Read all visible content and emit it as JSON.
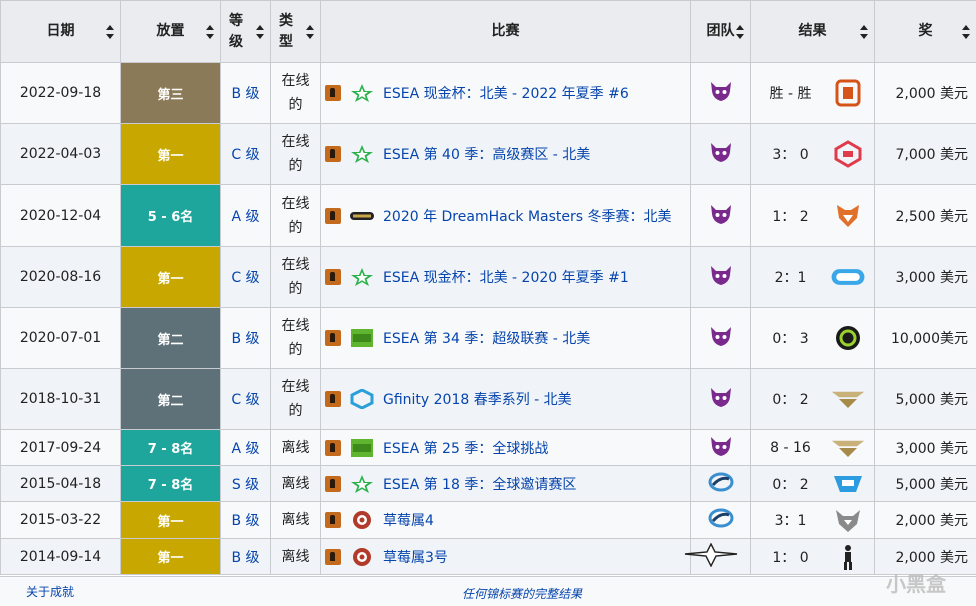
{
  "headers": {
    "date": "日期",
    "place": "放置",
    "tier": "等级",
    "type": "类型",
    "tournament": "比赛",
    "team": "团队",
    "result": "结果",
    "prize": "奖"
  },
  "rows": [
    {
      "date": "2022-09-18",
      "place": "第三",
      "tier": "B 级",
      "type": "在线的",
      "tournament": "ESEA 现金杯：北美 - 2022 年夏季 #6",
      "org": "star",
      "team": "demon",
      "score": "胜 - 胜",
      "opp": "dc",
      "prize": "2,000 美元",
      "placeColor": "#8b7a57"
    },
    {
      "date": "2022-04-03",
      "place": "第一",
      "tier": "C 级",
      "type": "在线的",
      "tournament": "ESEA 第 40 季：高级赛区 - 北美",
      "org": "star",
      "team": "demon",
      "score": "3： 0",
      "opp": "gc",
      "prize": "7,000 美元",
      "placeColor": "#c8a800"
    },
    {
      "date": "2020-12-04",
      "place": "5 - 6名",
      "tier": "A 级",
      "type": "在线的",
      "tournament": "2020 年 DreamHack Masters 冬季赛：北美",
      "org": "masters",
      "team": "demon",
      "score": "1： 2",
      "opp": "fox",
      "prize": "2,500 美元",
      "placeColor": "#1fa69c"
    },
    {
      "date": "2020-08-16",
      "place": "第一",
      "tier": "C 级",
      "type": "在线的",
      "tournament": "ESEA 现金杯：北美 - 2020 年夏季 #1",
      "org": "star",
      "team": "demon",
      "score": "2：1",
      "opp": "pd",
      "prize": "3,000 美元",
      "placeColor": "#c8a800"
    },
    {
      "date": "2020-07-01",
      "place": "第二",
      "tier": "B 级",
      "type": "在线的",
      "tournament": "ESEA 第 34 季：超级联赛 - 北美",
      "org": "mdl",
      "team": "demon",
      "score": "0： 3",
      "opp": "ring",
      "prize": "10,000美元",
      "placeColor": "#5e7178"
    },
    {
      "date": "2018-10-31",
      "place": "第二",
      "tier": "C 级",
      "type": "在线的",
      "tournament": "Gfinity 2018 春季系列 - 北美",
      "org": "gfinity",
      "team": "demon",
      "score": "0： 2",
      "opp": "wings",
      "prize": "5,000 美元",
      "placeColor": "#5e7178"
    },
    {
      "date": "2017-09-24",
      "place": "7 - 8名",
      "tier": "A 级",
      "type": "离线",
      "tournament": "ESEA 第 25 季：全球挑战",
      "org": "mdl",
      "team": "demon",
      "score": "8 - 16",
      "opp": "wings",
      "prize": "3,000 美元",
      "placeColor": "#1fa69c"
    },
    {
      "date": "2015-04-18",
      "place": "7 - 8名",
      "tier": "S 级",
      "type": "离线",
      "tournament": "ESEA 第 18 季：全球邀请赛区",
      "org": "star",
      "team": "swirl",
      "score": "0： 2",
      "opp": "clg",
      "prize": "5,000 美元",
      "placeColor": "#1fa69c"
    },
    {
      "date": "2015-03-22",
      "place": "第一",
      "tier": "B 级",
      "type": "离线",
      "tournament": "草莓属4",
      "org": "fragaria",
      "team": "swirl",
      "score": "3：1",
      "opp": "wolf",
      "prize": "2,000 美元",
      "placeColor": "#c8a800"
    },
    {
      "date": "2014-09-14",
      "place": "第一",
      "tier": "B 级",
      "type": "离线",
      "tournament": "草莓属3号",
      "org": "fragaria",
      "team": "bigstar",
      "score": "1： 0",
      "opp": "soldier",
      "prize": "2,000 美元",
      "placeColor": "#c8a800"
    }
  ],
  "footer": {
    "left_link": "关于成就",
    "center_link": "任何锦标赛的完整结果"
  },
  "watermark": "小黑盒"
}
